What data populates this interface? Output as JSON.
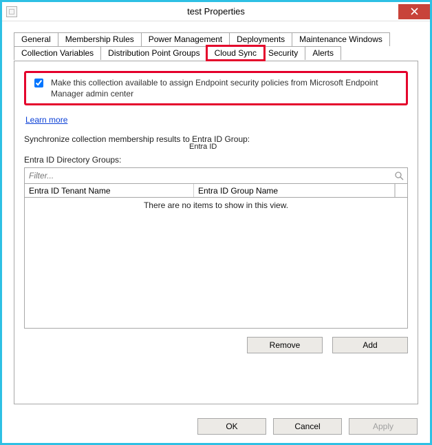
{
  "window": {
    "title": "test Properties"
  },
  "tabs": {
    "row1": [
      "General",
      "Membership Rules",
      "Power Management",
      "Deployments",
      "Maintenance Windows"
    ],
    "row2": [
      "Collection Variables",
      "Distribution Point Groups",
      "Cloud Sync",
      "Security",
      "Alerts"
    ],
    "active": "Cloud Sync"
  },
  "cloudsync": {
    "checkbox_label": "Make this collection available to assign Endpoint security policies from Microsoft Endpoint Manager admin center",
    "checkbox_checked": true,
    "learn_more": "Learn more",
    "sync_text": "Synchronize collection membership results to  Entra ID Group:",
    "floating_label": "Entra ID",
    "dir_groups_label": "Entra ID Directory Groups:",
    "filter_placeholder": "Filter...",
    "columns": {
      "tenant": "Entra ID  Tenant  Name",
      "group": "Entra ID  Group  Name"
    },
    "empty_message": "There are no items to show in this view.",
    "remove_label": "Remove",
    "add_label": "Add"
  },
  "dialog_buttons": {
    "ok": "OK",
    "cancel": "Cancel",
    "apply": "Apply"
  }
}
